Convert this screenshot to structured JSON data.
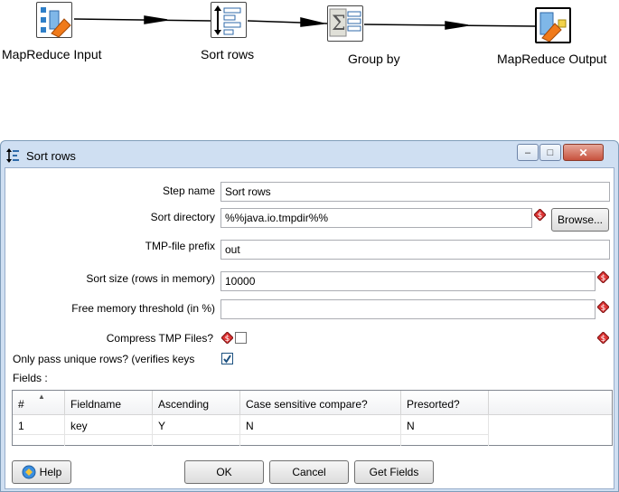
{
  "canvas": {
    "steps": [
      {
        "label": "MapReduce Input"
      },
      {
        "label": "Sort rows"
      },
      {
        "label": "Group by"
      },
      {
        "label": "MapReduce Output"
      }
    ]
  },
  "dialog": {
    "title": "Sort rows",
    "window_buttons": {
      "minimize": "–",
      "maximize": "□",
      "close": "✕"
    },
    "step_name": {
      "label": "Step name",
      "value": "Sort rows"
    },
    "sort_directory": {
      "label": "Sort directory",
      "value": "%%java.io.tmpdir%%",
      "browse": "Browse..."
    },
    "tmp_prefix": {
      "label": "TMP-file prefix",
      "value": "out"
    },
    "sort_size": {
      "label": "Sort size (rows in memory)",
      "value": "10000"
    },
    "free_memory": {
      "label": "Free memory threshold (in %)",
      "value": ""
    },
    "compress": {
      "label": "Compress TMP Files?",
      "checked": false
    },
    "unique_rows": {
      "label": "Only pass unique rows? (verifies keys",
      "checked": true
    },
    "fields_label": "Fields :",
    "table": {
      "headers": [
        "#",
        "Fieldname",
        "Ascending",
        "Case sensitive compare?",
        "Presorted?"
      ],
      "rows": [
        [
          "1",
          "key",
          "Y",
          "N",
          "N"
        ]
      ]
    },
    "buttons": {
      "help": "Help",
      "ok": "OK",
      "cancel": "Cancel",
      "get_fields": "Get Fields"
    }
  },
  "colors": {
    "accent": "#1c5180",
    "window_frame": "#cfdff2"
  }
}
